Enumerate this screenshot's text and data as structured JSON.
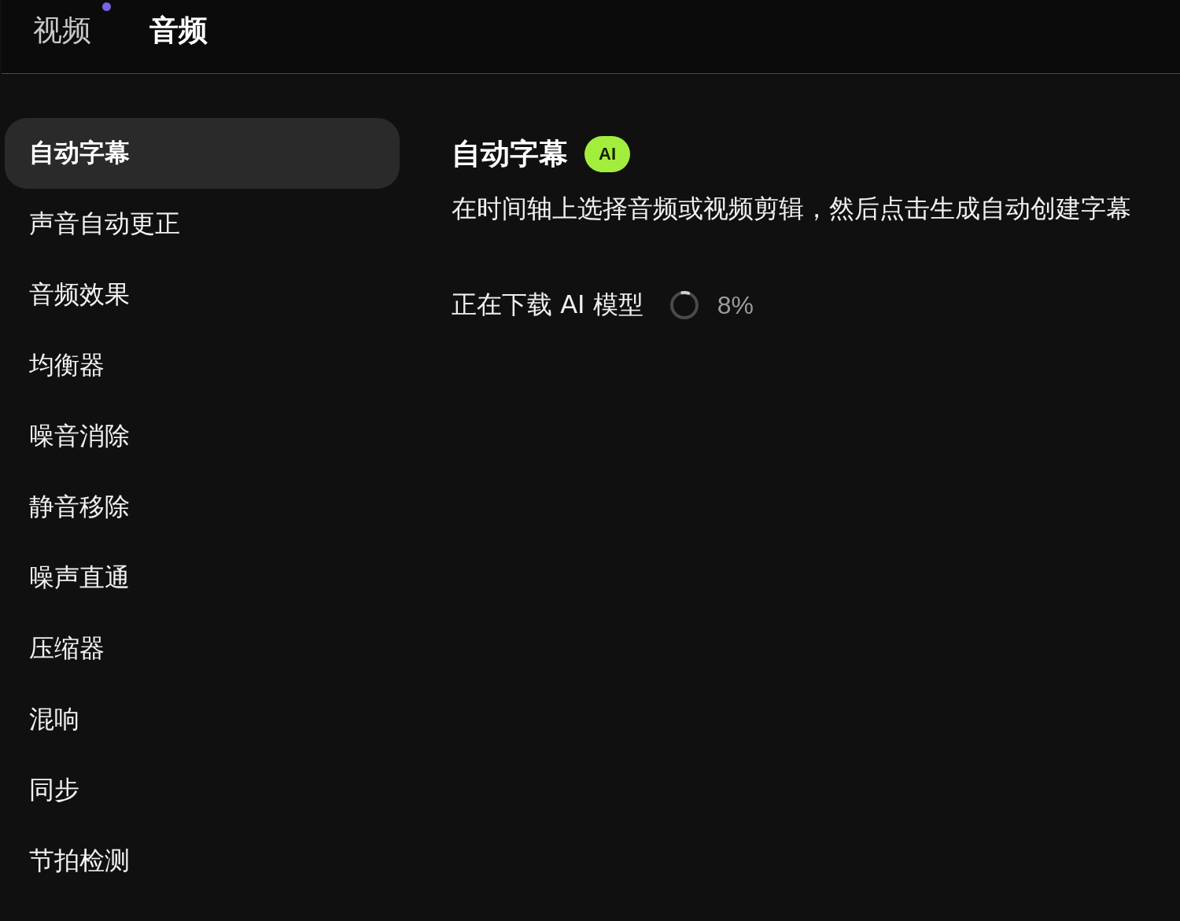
{
  "tabs": [
    {
      "label": "视频",
      "selected": false,
      "dot": true
    },
    {
      "label": "音频",
      "selected": true,
      "dot": false
    }
  ],
  "sidebar": {
    "items": [
      {
        "label": "自动字幕",
        "selected": true
      },
      {
        "label": "声音自动更正",
        "selected": false
      },
      {
        "label": "音频效果",
        "selected": false
      },
      {
        "label": "均衡器",
        "selected": false
      },
      {
        "label": "噪音消除",
        "selected": false
      },
      {
        "label": "静音移除",
        "selected": false
      },
      {
        "label": "噪声直通",
        "selected": false
      },
      {
        "label": "压缩器",
        "selected": false
      },
      {
        "label": "混响",
        "selected": false
      },
      {
        "label": "同步",
        "selected": false
      },
      {
        "label": "节拍检测",
        "selected": false
      }
    ]
  },
  "panel": {
    "title": "自动字幕",
    "badge": "AI",
    "description": "在时间轴上选择音频或视频剪辑，然后点击生成自动创建字幕",
    "download": {
      "label": "正在下载 AI 模型",
      "level": 0.08,
      "percent": "8%"
    }
  }
}
